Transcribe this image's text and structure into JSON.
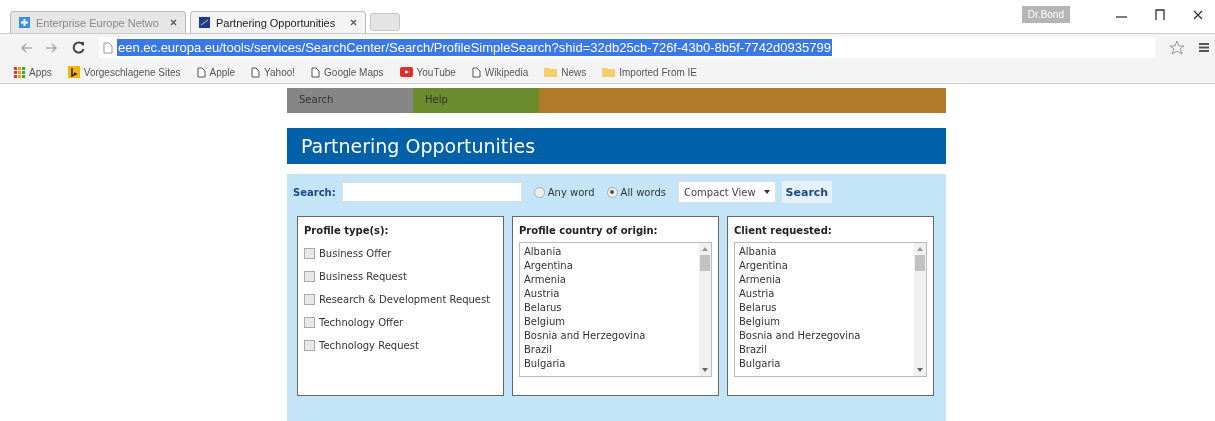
{
  "browser": {
    "tabs": [
      {
        "title": "Enterprise Europe Netwo",
        "selected": false
      },
      {
        "title": "Partnering Opportunities",
        "selected": true
      }
    ],
    "profile_name": "Dr.Bond",
    "address": "een.ec.europa.eu/tools/services/SearchCenter/Search/ProfileSimpleSearch?shid=32db25cb-726f-43b0-8b5f-7742d0935799",
    "bookmarks": [
      {
        "label": "Apps",
        "kind": "apps"
      },
      {
        "label": "Vorgeschlagene Sites",
        "kind": "bing"
      },
      {
        "label": "Apple",
        "kind": "page"
      },
      {
        "label": "Yahoo!",
        "kind": "page"
      },
      {
        "label": "Google Maps",
        "kind": "page"
      },
      {
        "label": "YouTube",
        "kind": "video"
      },
      {
        "label": "Wikipedia",
        "kind": "page"
      },
      {
        "label": "News",
        "kind": "folder"
      },
      {
        "label": "Imported From IE",
        "kind": "folder"
      }
    ]
  },
  "page": {
    "nav": [
      {
        "label": "Search",
        "color": "#868686"
      },
      {
        "label": "Help",
        "color": "#6a8c2c"
      }
    ],
    "title": "Partnering Opportunities",
    "search": {
      "label": "Search:",
      "options": [
        {
          "label": "Any word",
          "selected": false
        },
        {
          "label": "All words",
          "selected": true
        }
      ],
      "view": "Compact View",
      "button": "Search"
    },
    "profile_types": {
      "title": "Profile type(s):",
      "items": [
        {
          "label": "Business Offer",
          "checked": false
        },
        {
          "label": "Business Request",
          "checked": false
        },
        {
          "label": "Research & Development Request",
          "checked": false
        },
        {
          "label": "Technology Offer",
          "checked": false
        },
        {
          "label": "Technology Request",
          "checked": false
        }
      ]
    },
    "country_of_origin": {
      "title": "Profile country of origin:",
      "options": [
        "Albania",
        "Argentina",
        "Armenia",
        "Austria",
        "Belarus",
        "Belgium",
        "Bosnia and Herzegovina",
        "Brazil",
        "Bulgaria"
      ]
    },
    "client_requested": {
      "title": "Client requested:",
      "options": [
        "Albania",
        "Argentina",
        "Armenia",
        "Austria",
        "Belarus",
        "Belgium",
        "Bosnia and Herzegovina",
        "Brazil",
        "Bulgaria"
      ]
    }
  }
}
